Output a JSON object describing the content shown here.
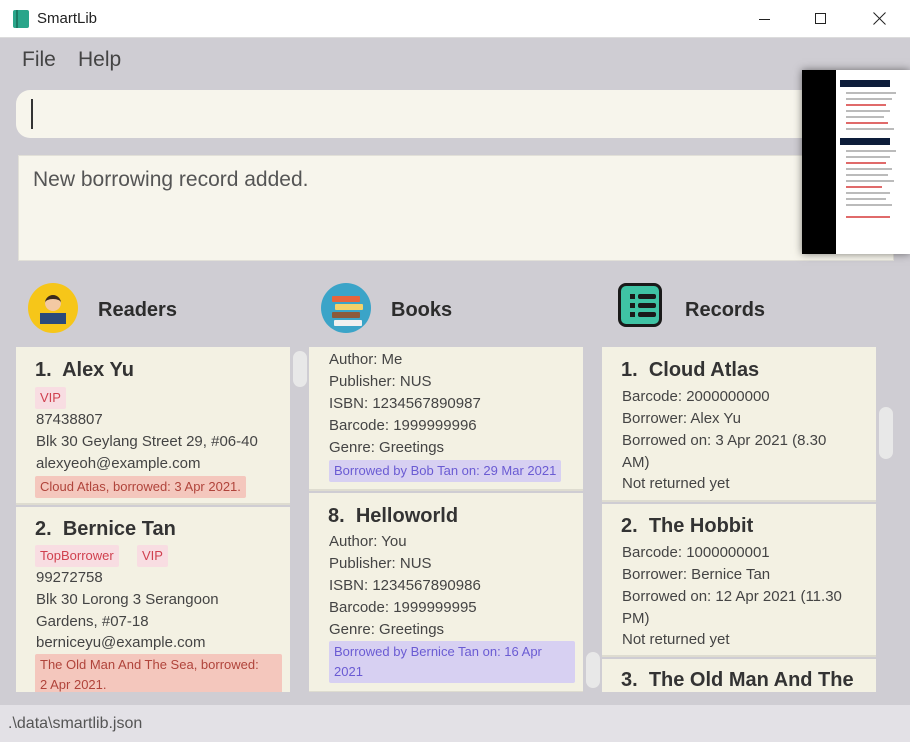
{
  "window": {
    "title": "SmartLib"
  },
  "menu": {
    "file": "File",
    "help": "Help"
  },
  "command": {
    "value": ""
  },
  "result": {
    "text": "New borrowing record added."
  },
  "panels": {
    "readers": "Readers",
    "books": "Books",
    "records": "Records"
  },
  "readers": [
    {
      "index": "1.",
      "name": "Alex Yu",
      "tags": [
        "VIP"
      ],
      "phone": "87438807",
      "address": "Blk 30 Geylang Street 29, #06-40",
      "email": "alexyeoh@example.com",
      "borrowed": "Cloud Atlas, borrowed: 3 Apr 2021."
    },
    {
      "index": "2.",
      "name": "Bernice Tan",
      "tags": [
        "TopBorrower",
        "VIP"
      ],
      "phone": "99272758",
      "address_line1": "Blk 30 Lorong 3 Serangoon",
      "address_line2": "Gardens, #07-18",
      "email": "berniceyu@example.com",
      "borrowed_line1": "The Old Man And The Sea, borrowed:",
      "borrowed_line2": "2 Apr 2021."
    }
  ],
  "books": [
    {
      "author": "Author: Me",
      "publisher": "Publisher: NUS",
      "isbn": "ISBN: 1234567890987",
      "barcode": "Barcode: 1999999996",
      "genre": "Genre: Greetings",
      "borrowed": "Borrowed by Bob Tan on: 29 Mar 2021"
    },
    {
      "index": "8.",
      "title": "Helloworld",
      "author": "Author: You",
      "publisher": "Publisher: NUS",
      "isbn": "ISBN: 1234567890986",
      "barcode": "Barcode: 1999999995",
      "genre": "Genre: Greetings",
      "borrowed_line1": "Borrowed by Bernice Tan on: 16 Apr",
      "borrowed_line2": "2021"
    }
  ],
  "records": [
    {
      "index": "1.",
      "title": "Cloud Atlas",
      "barcode": "Barcode: 2000000000",
      "borrower": "Borrower: Alex Yu",
      "borrowed_line1": "Borrowed on: 3 Apr 2021 (8.30",
      "borrowed_line2": "AM)",
      "status": "Not returned yet"
    },
    {
      "index": "2.",
      "title": "The Hobbit",
      "barcode": "Barcode: 1000000001",
      "borrower": "Borrower: Bernice Tan",
      "borrowed_line1": "Borrowed on: 12 Apr 2021 (11.30",
      "borrowed_line2": "PM)",
      "status": "Not returned yet"
    },
    {
      "index": "3.",
      "title": "The Old Man And The"
    }
  ],
  "status_bar": {
    "path": ".\\data\\smartlib.json"
  },
  "colors": {
    "background": "#cfcdd3",
    "card": "#f3f1e3",
    "tag_pink": "#f8dde2",
    "tag_borrow": "#f4c7bd",
    "tag_purple": "#d7d0f2"
  },
  "icons": {
    "app": "book-icon",
    "readers": "reader-icon",
    "books": "books-stack-icon",
    "records": "records-list-icon"
  }
}
